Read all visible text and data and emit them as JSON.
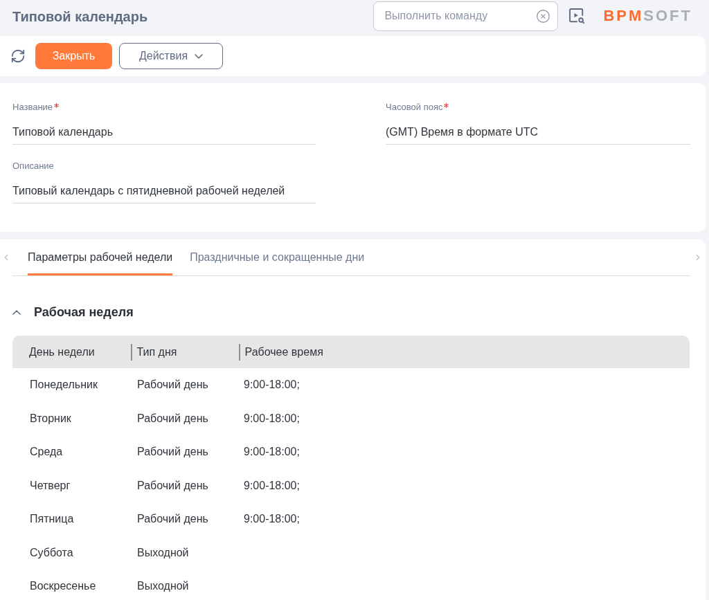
{
  "header": {
    "title": "Типовой календарь",
    "command_search": {
      "placeholder": "Выполнить команду"
    },
    "logo": {
      "primary": "BPM",
      "secondary": "SOFT"
    }
  },
  "toolbar": {
    "buttons": [
      {
        "label": "Закрыть",
        "kind": "primary"
      },
      {
        "label": "Действия",
        "kind": "menu"
      }
    ]
  },
  "form": {
    "columns": [
      [
        {
          "label": "Название",
          "required": true,
          "value": "Типовой календарь"
        },
        {
          "label": "Описание",
          "required": false,
          "value": "Типовый календарь с пятидневной рабочей неделей"
        }
      ],
      [
        {
          "label": "Часовой пояс",
          "required": true,
          "value": "(GMT) Время в формате UTC"
        }
      ]
    ]
  },
  "tabs": [
    {
      "label": "Параметры рабочей недели",
      "selected": true
    },
    {
      "label": "Праздничные и сокращенные дни",
      "selected": false
    }
  ],
  "section": {
    "title": "Рабочая неделя",
    "expanded": true
  },
  "table": {
    "columns": [
      "День недели",
      "Тип дня",
      "Рабочее время"
    ],
    "rows": [
      {
        "day": "Понедельник",
        "day_type": "Рабочий день",
        "working_time": "9:00-18:00;"
      },
      {
        "day": "Вторник",
        "day_type": "Рабочий день",
        "working_time": "9:00-18:00;"
      },
      {
        "day": "Среда",
        "day_type": "Рабочий день",
        "working_time": "9:00-18:00;"
      },
      {
        "day": "Четверг",
        "day_type": "Рабочий день",
        "working_time": "9:00-18:00;"
      },
      {
        "day": "Пятница",
        "day_type": "Рабочий день",
        "working_time": "9:00-18:00;"
      },
      {
        "day": "Суббота",
        "day_type": "Выходной"
      },
      {
        "day": "Воскресенье",
        "day_type": "Выходной"
      }
    ]
  }
}
